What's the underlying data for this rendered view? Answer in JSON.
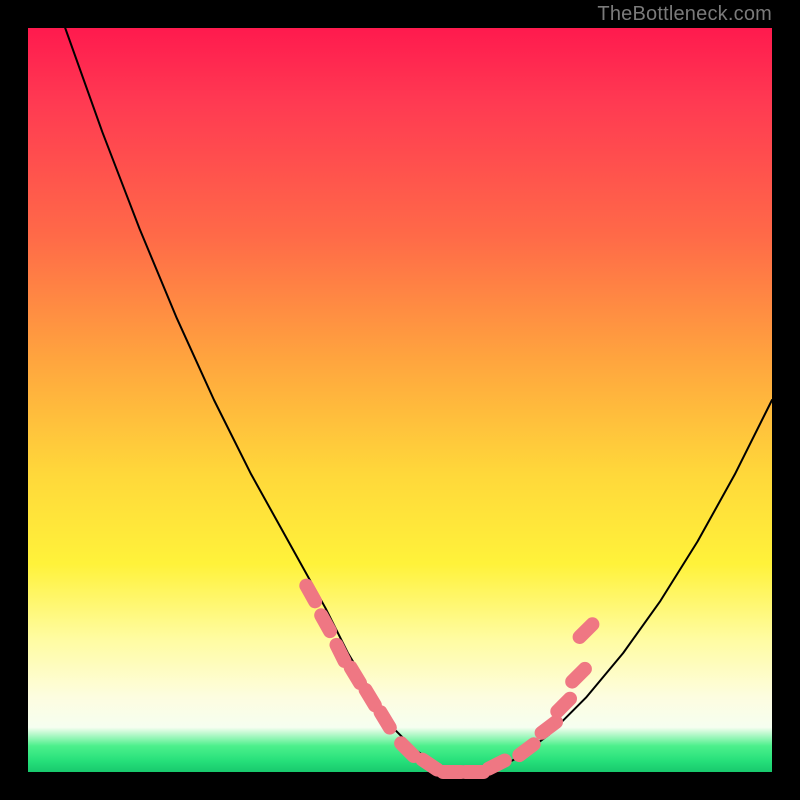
{
  "watermark": "TheBottleneck.com",
  "colors": {
    "frame": "#000000",
    "curve": "#000000",
    "marker": "#ef7783",
    "gradient_top": "#ff1a4e",
    "gradient_bottom": "#18c96d"
  },
  "chart_data": {
    "type": "line",
    "title": "",
    "xlabel": "",
    "ylabel": "",
    "xlim": [
      0,
      100
    ],
    "ylim": [
      0,
      100
    ],
    "grid": false,
    "legend": false,
    "annotations": [
      "TheBottleneck.com"
    ],
    "series": [
      {
        "name": "bottleneck-curve",
        "x": [
          5,
          10,
          15,
          20,
          25,
          30,
          35,
          40,
          43,
          46,
          49,
          52,
          55,
          58,
          62,
          66,
          70,
          75,
          80,
          85,
          90,
          95,
          100
        ],
        "values": [
          100,
          86,
          73,
          61,
          50,
          40,
          31,
          22,
          16,
          11,
          6,
          3,
          1,
          0,
          0,
          2,
          5,
          10,
          16,
          23,
          31,
          40,
          50
        ]
      }
    ],
    "markers": [
      {
        "name": "left-cluster-1",
        "x": 38,
        "y": 24
      },
      {
        "name": "left-cluster-2",
        "x": 40,
        "y": 20
      },
      {
        "name": "left-cluster-3",
        "x": 42,
        "y": 16
      },
      {
        "name": "left-cluster-4",
        "x": 44,
        "y": 13
      },
      {
        "name": "left-cluster-5",
        "x": 46,
        "y": 10
      },
      {
        "name": "left-cluster-6",
        "x": 48,
        "y": 7
      },
      {
        "name": "bottom-1",
        "x": 51,
        "y": 3
      },
      {
        "name": "bottom-2",
        "x": 54,
        "y": 1
      },
      {
        "name": "bottom-3",
        "x": 57,
        "y": 0
      },
      {
        "name": "bottom-4",
        "x": 60,
        "y": 0
      },
      {
        "name": "bottom-5",
        "x": 63,
        "y": 1
      },
      {
        "name": "right-cluster-1",
        "x": 67,
        "y": 3
      },
      {
        "name": "right-cluster-2",
        "x": 70,
        "y": 6
      },
      {
        "name": "right-cluster-3",
        "x": 72,
        "y": 9
      },
      {
        "name": "right-cluster-4",
        "x": 74,
        "y": 13
      },
      {
        "name": "right-stray",
        "x": 75,
        "y": 19
      }
    ]
  }
}
